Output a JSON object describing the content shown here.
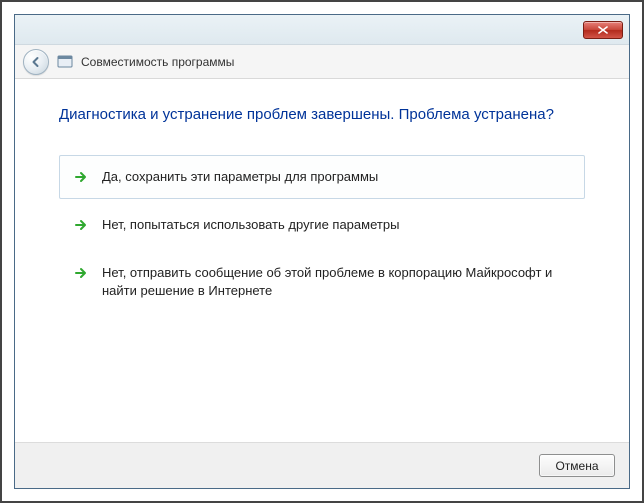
{
  "window": {
    "title": "Совместимость программы"
  },
  "heading": "Диагностика и устранение проблем завершены. Проблема устранена?",
  "options": [
    {
      "label": "Да, сохранить эти параметры для программы"
    },
    {
      "label": "Нет, попытаться использовать другие параметры"
    },
    {
      "label": "Нет, отправить сообщение об этой проблеме в корпорацию Майкрософт и найти решение в Интернете"
    }
  ],
  "buttons": {
    "cancel": "Отмена"
  }
}
